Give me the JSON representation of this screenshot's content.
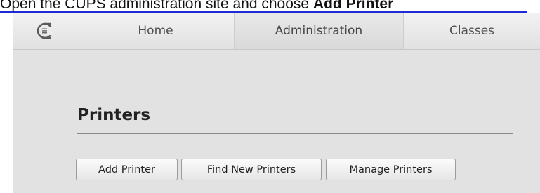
{
  "caption": {
    "text_before": "Open the CUPS administration site and choose ",
    "text_bold": "Add Printer"
  },
  "navbar": {
    "logo_icon": "cups-logo-icon",
    "tabs": [
      {
        "label": "Home",
        "active": false
      },
      {
        "label": "Administration",
        "active": true
      },
      {
        "label": "Classes",
        "active": false
      }
    ]
  },
  "content": {
    "heading": "Printers",
    "buttons": {
      "add_printer": "Add Printer",
      "find_new_printers": "Find New Printers",
      "manage_printers": "Manage Printers"
    }
  },
  "colors": {
    "page_background": "#e2e2e2",
    "navbar_background": "#ececec",
    "active_tab": "#dedede",
    "caption_underline": "#1e2bd0"
  }
}
